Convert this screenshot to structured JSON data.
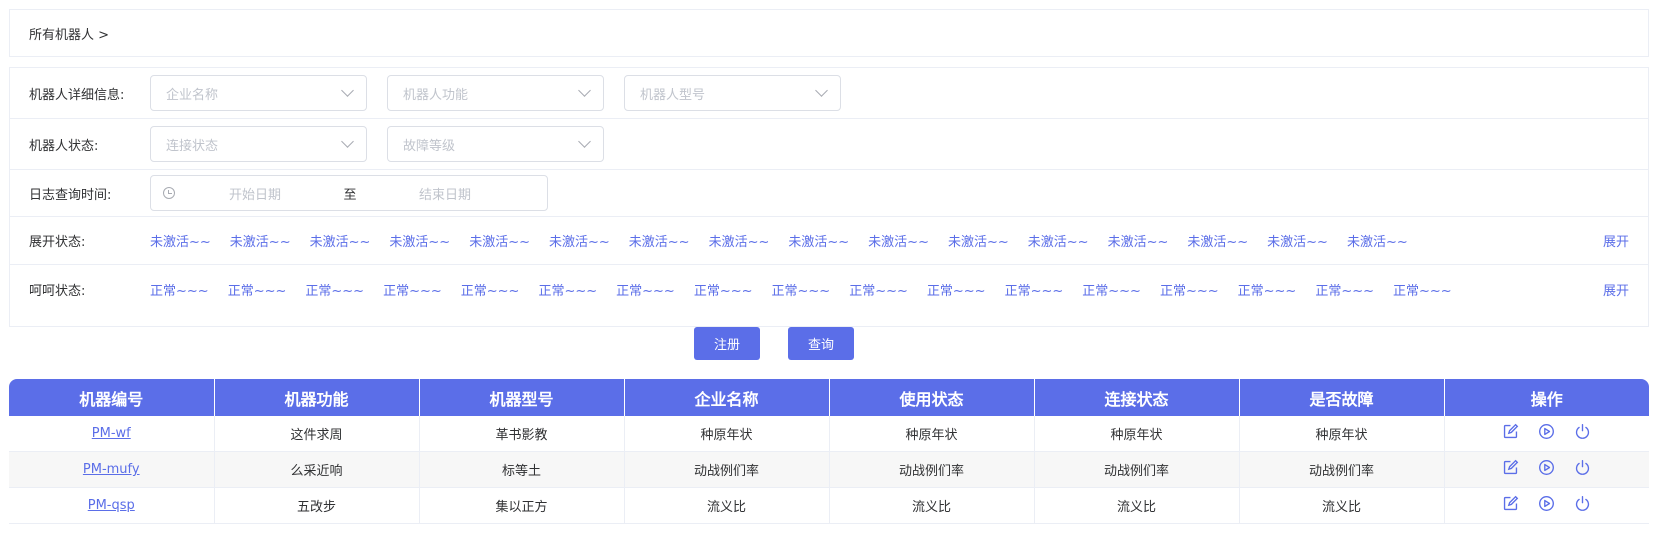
{
  "breadcrumb": "所有机器人 >",
  "filters": {
    "detail_label": "机器人详细信息:",
    "company_placeholder": "企业名称",
    "function_placeholder": "机器人功能",
    "model_placeholder": "机器人型号",
    "status_label": "机器人状态:",
    "connect_placeholder": "连接状态",
    "fault_placeholder": "故障等级",
    "log_label": "日志查询时间:",
    "start_date": "开始日期",
    "date_sep": "至",
    "end_date": "结束日期",
    "expand_label": "展开状态:",
    "expand_tags": [
      "未激活~~",
      "未激活~~",
      "未激活~~",
      "未激活~~",
      "未激活~~",
      "未激活~~",
      "未激活~~",
      "未激活~~",
      "未激活~~",
      "未激活~~",
      "未激活~~",
      "未激活~~",
      "未激活~~",
      "未激活~~",
      "未激活~~",
      "未激活~~"
    ],
    "expand_link": "展开",
    "hehe_label": "呵呵状态:",
    "hehe_tags": [
      "正常~~~",
      "正常~~~",
      "正常~~~",
      "正常~~~",
      "正常~~~",
      "正常~~~",
      "正常~~~",
      "正常~~~",
      "正常~~~",
      "正常~~~",
      "正常~~~",
      "正常~~~",
      "正常~~~",
      "正常~~~",
      "正常~~~",
      "正常~~~",
      "正常~~~"
    ],
    "hehe_link": "展开"
  },
  "buttons": {
    "register": "注册",
    "query": "查询"
  },
  "table": {
    "headers": [
      "机器编号",
      "机器功能",
      "机器型号",
      "企业名称",
      "使用状态",
      "连接状态",
      "是否故障",
      "操作"
    ],
    "rows": [
      [
        "PM-wf",
        "这件求周",
        "革书影教",
        "种原年状",
        "种原年状",
        "种原年状",
        "种原年状"
      ],
      [
        "PM-mufy",
        "么采近响",
        "标等土",
        "动战例们率",
        "动战例们率",
        "动战例们率",
        "动战例们率"
      ],
      [
        "PM-qsp",
        "五改步",
        "集以正方",
        "流义比",
        "流义比",
        "流义比",
        "流义比"
      ]
    ],
    "row_icons": [
      "edit-icon",
      "play-icon",
      "power-icon"
    ]
  },
  "colors": {
    "accent": "#5b6ee8",
    "border": "#ebeef5"
  }
}
